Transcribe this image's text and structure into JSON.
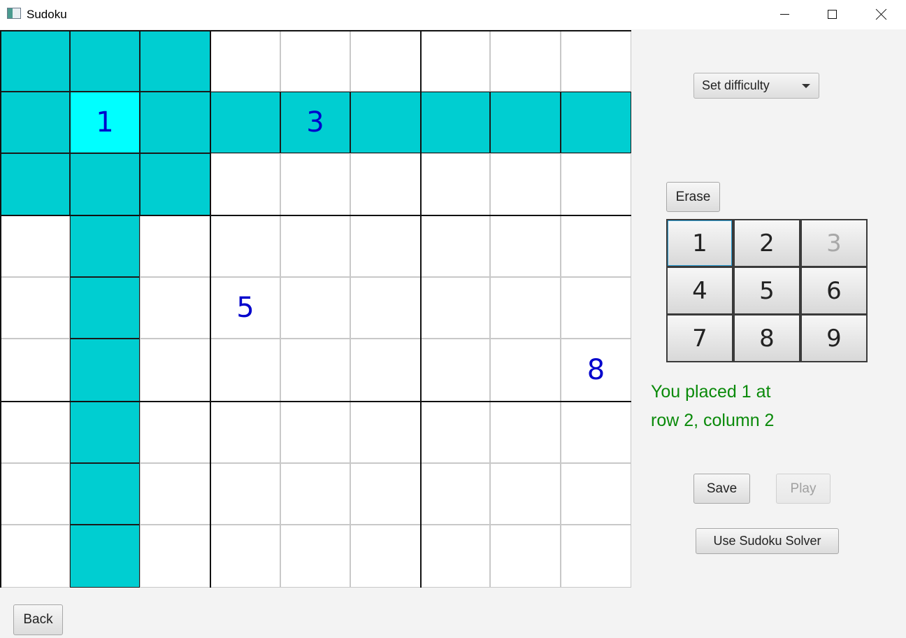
{
  "window": {
    "title": "Sudoku",
    "minimize_icon": "minimize-icon",
    "maximize_icon": "maximize-icon",
    "close_icon": "close-icon"
  },
  "board": {
    "selected": {
      "row": 2,
      "col": 2
    },
    "highlight_color": "#00ced1",
    "selected_color": "#00ffff",
    "digit_color": "#0000cc",
    "cells": [
      [
        "",
        "",
        "",
        "",
        "",
        "",
        "",
        "",
        ""
      ],
      [
        "",
        "1",
        "",
        "",
        "3",
        "",
        "",
        "",
        ""
      ],
      [
        "",
        "",
        "",
        "",
        "",
        "",
        "",
        "",
        ""
      ],
      [
        "",
        "",
        "",
        "",
        "",
        "",
        "",
        "",
        ""
      ],
      [
        "",
        "",
        "",
        "5",
        "",
        "",
        "",
        "",
        ""
      ],
      [
        "",
        "",
        "",
        "",
        "",
        "",
        "",
        "",
        "8"
      ],
      [
        "",
        "",
        "",
        "",
        "",
        "",
        "",
        "",
        ""
      ],
      [
        "",
        "",
        "",
        "",
        "",
        "",
        "",
        "",
        ""
      ],
      [
        "",
        "",
        "",
        "",
        "",
        "",
        "",
        "",
        ""
      ]
    ]
  },
  "controls": {
    "difficulty_label": "Set difficulty",
    "erase_label": "Erase",
    "numpad": [
      {
        "label": "1",
        "enabled": true,
        "focused": true
      },
      {
        "label": "2",
        "enabled": true,
        "focused": false
      },
      {
        "label": "3",
        "enabled": false,
        "focused": false
      },
      {
        "label": "4",
        "enabled": true,
        "focused": false
      },
      {
        "label": "5",
        "enabled": true,
        "focused": false
      },
      {
        "label": "6",
        "enabled": true,
        "focused": false
      },
      {
        "label": "7",
        "enabled": true,
        "focused": false
      },
      {
        "label": "8",
        "enabled": true,
        "focused": false
      },
      {
        "label": "9",
        "enabled": true,
        "focused": false
      }
    ],
    "status_line1": "You placed 1 at",
    "status_line2": "row 2, column 2",
    "status_color": "#0a8a0a",
    "save_label": "Save",
    "play_label": "Play",
    "play_enabled": false,
    "solver_label": "Use Sudoku Solver",
    "back_label": "Back"
  }
}
